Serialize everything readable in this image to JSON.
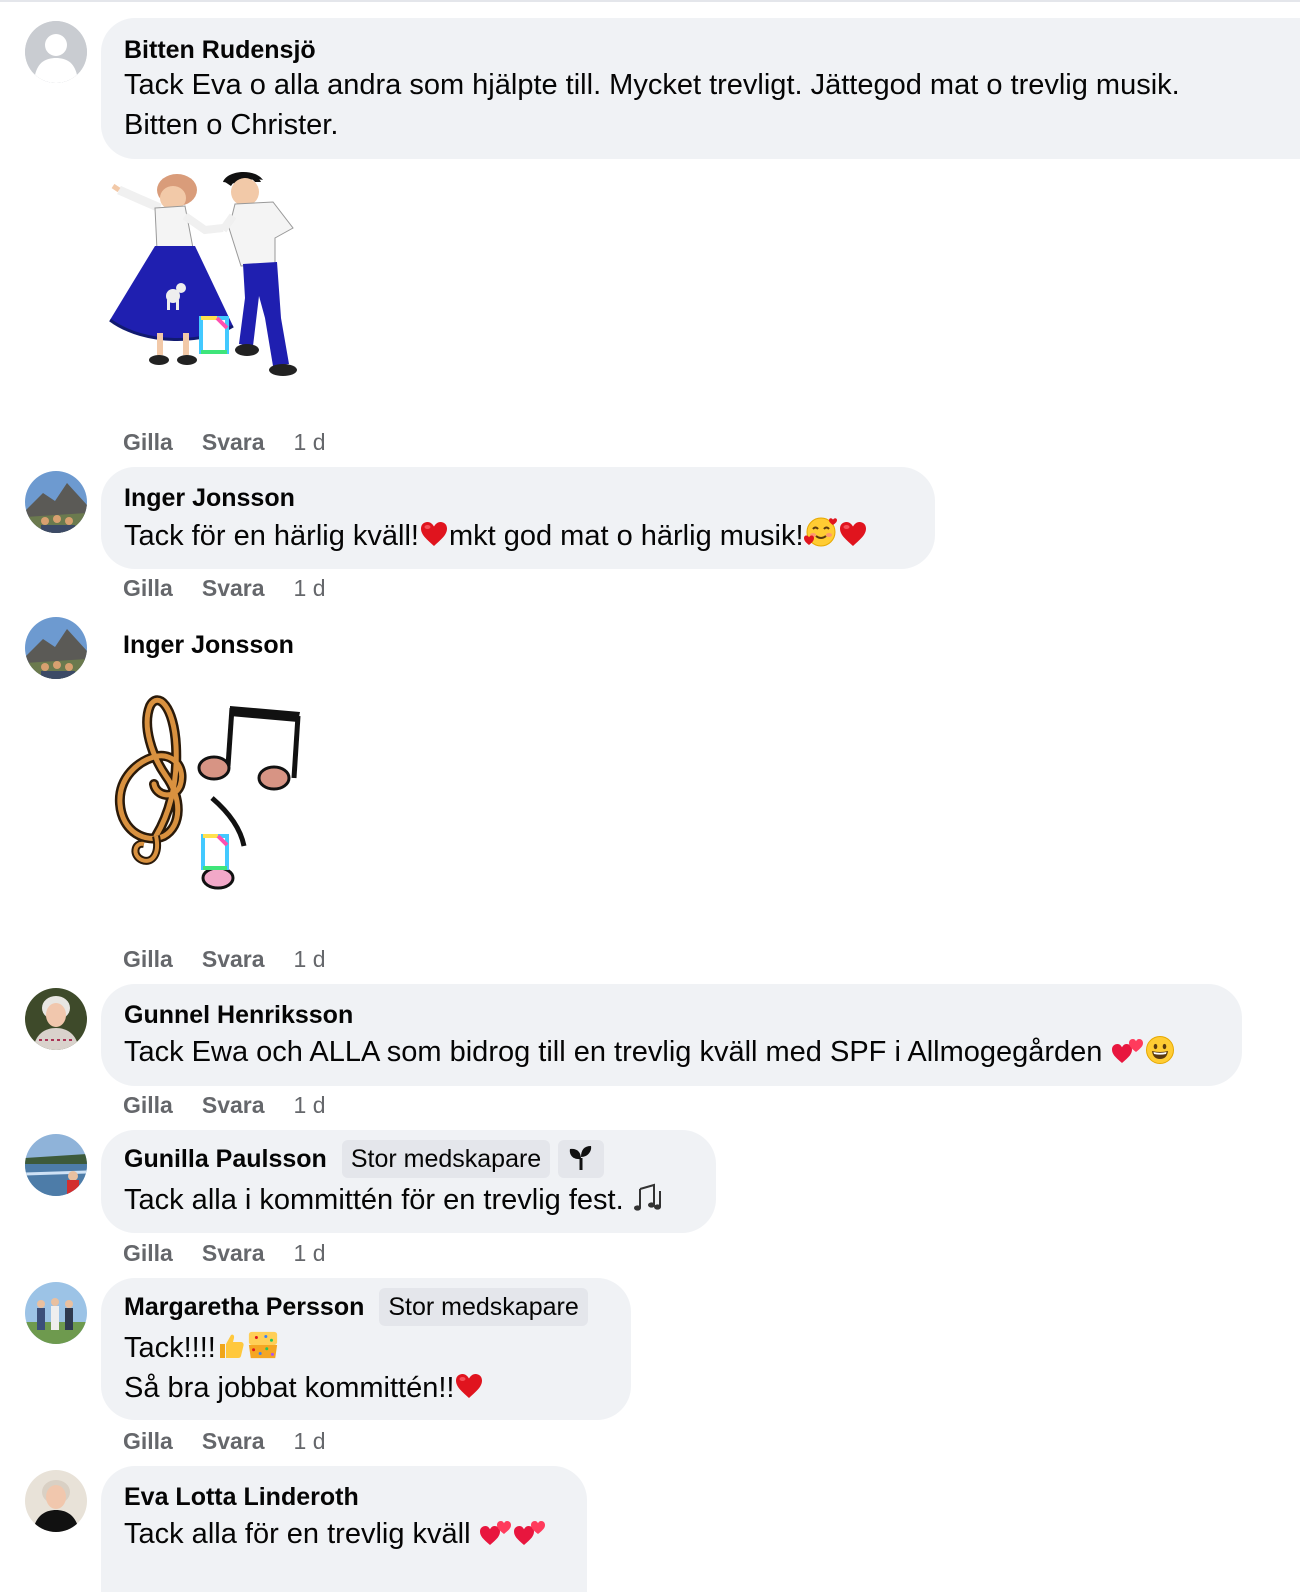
{
  "comments": [
    {
      "author": "Bitten Rudensjö",
      "lines": [
        "Tack Eva o alla andra som hjälpte till. Mycket trevligt. Jättegod mat o trevlig musik.",
        "Bitten o Christer."
      ],
      "actions": {
        "like": "Gilla",
        "reply": "Svara",
        "time": "1 d"
      }
    },
    {
      "author": "Inger Jonsson",
      "text_a": "Tack för en härlig kväll!",
      "text_b": "mkt god mat o härlig musik!",
      "actions": {
        "like": "Gilla",
        "reply": "Svara",
        "time": "1 d"
      }
    },
    {
      "author": "Inger Jonsson",
      "actions": {
        "like": "Gilla",
        "reply": "Svara",
        "time": "1 d"
      }
    },
    {
      "author": "Gunnel Henriksson",
      "text": "Tack Ewa och ALLA som bidrog till en trevlig kväll med SPF i Allmogegården",
      "actions": {
        "like": "Gilla",
        "reply": "Svara",
        "time": "1 d"
      }
    },
    {
      "author": "Gunilla Paulsson",
      "badge": "Stor medskapare",
      "text": "Tack alla i kommittén för en trevlig fest.",
      "actions": {
        "like": "Gilla",
        "reply": "Svara",
        "time": "1 d"
      }
    },
    {
      "author": "Margaretha Persson",
      "badge": "Stor medskapare",
      "line1": "Tack!!!!",
      "line2": "Så bra jobbat kommittén!!",
      "actions": {
        "like": "Gilla",
        "reply": "Svara",
        "time": "1 d"
      }
    },
    {
      "author": "Eva Lotta Linderoth",
      "text": "Tack alla för en trevlig kväll"
    }
  ],
  "icons": {
    "avatar_default": "default-user-avatar-icon",
    "heart": "red-heart-emoji",
    "hearts": "two-hearts-emoji",
    "smile": "grinning-face-emoji",
    "love": "smiling-face-with-hearts-emoji",
    "notes": "musical-notes-emoji",
    "thumb": "thumbs-up-emoji",
    "confetti": "confetti-emoji",
    "sprout": "seedling-icon"
  },
  "colors": {
    "bubble": "#f0f2f5",
    "secondary_text": "#65676b",
    "badge_bg": "#e4e6eb",
    "heart": "#e0141e"
  }
}
